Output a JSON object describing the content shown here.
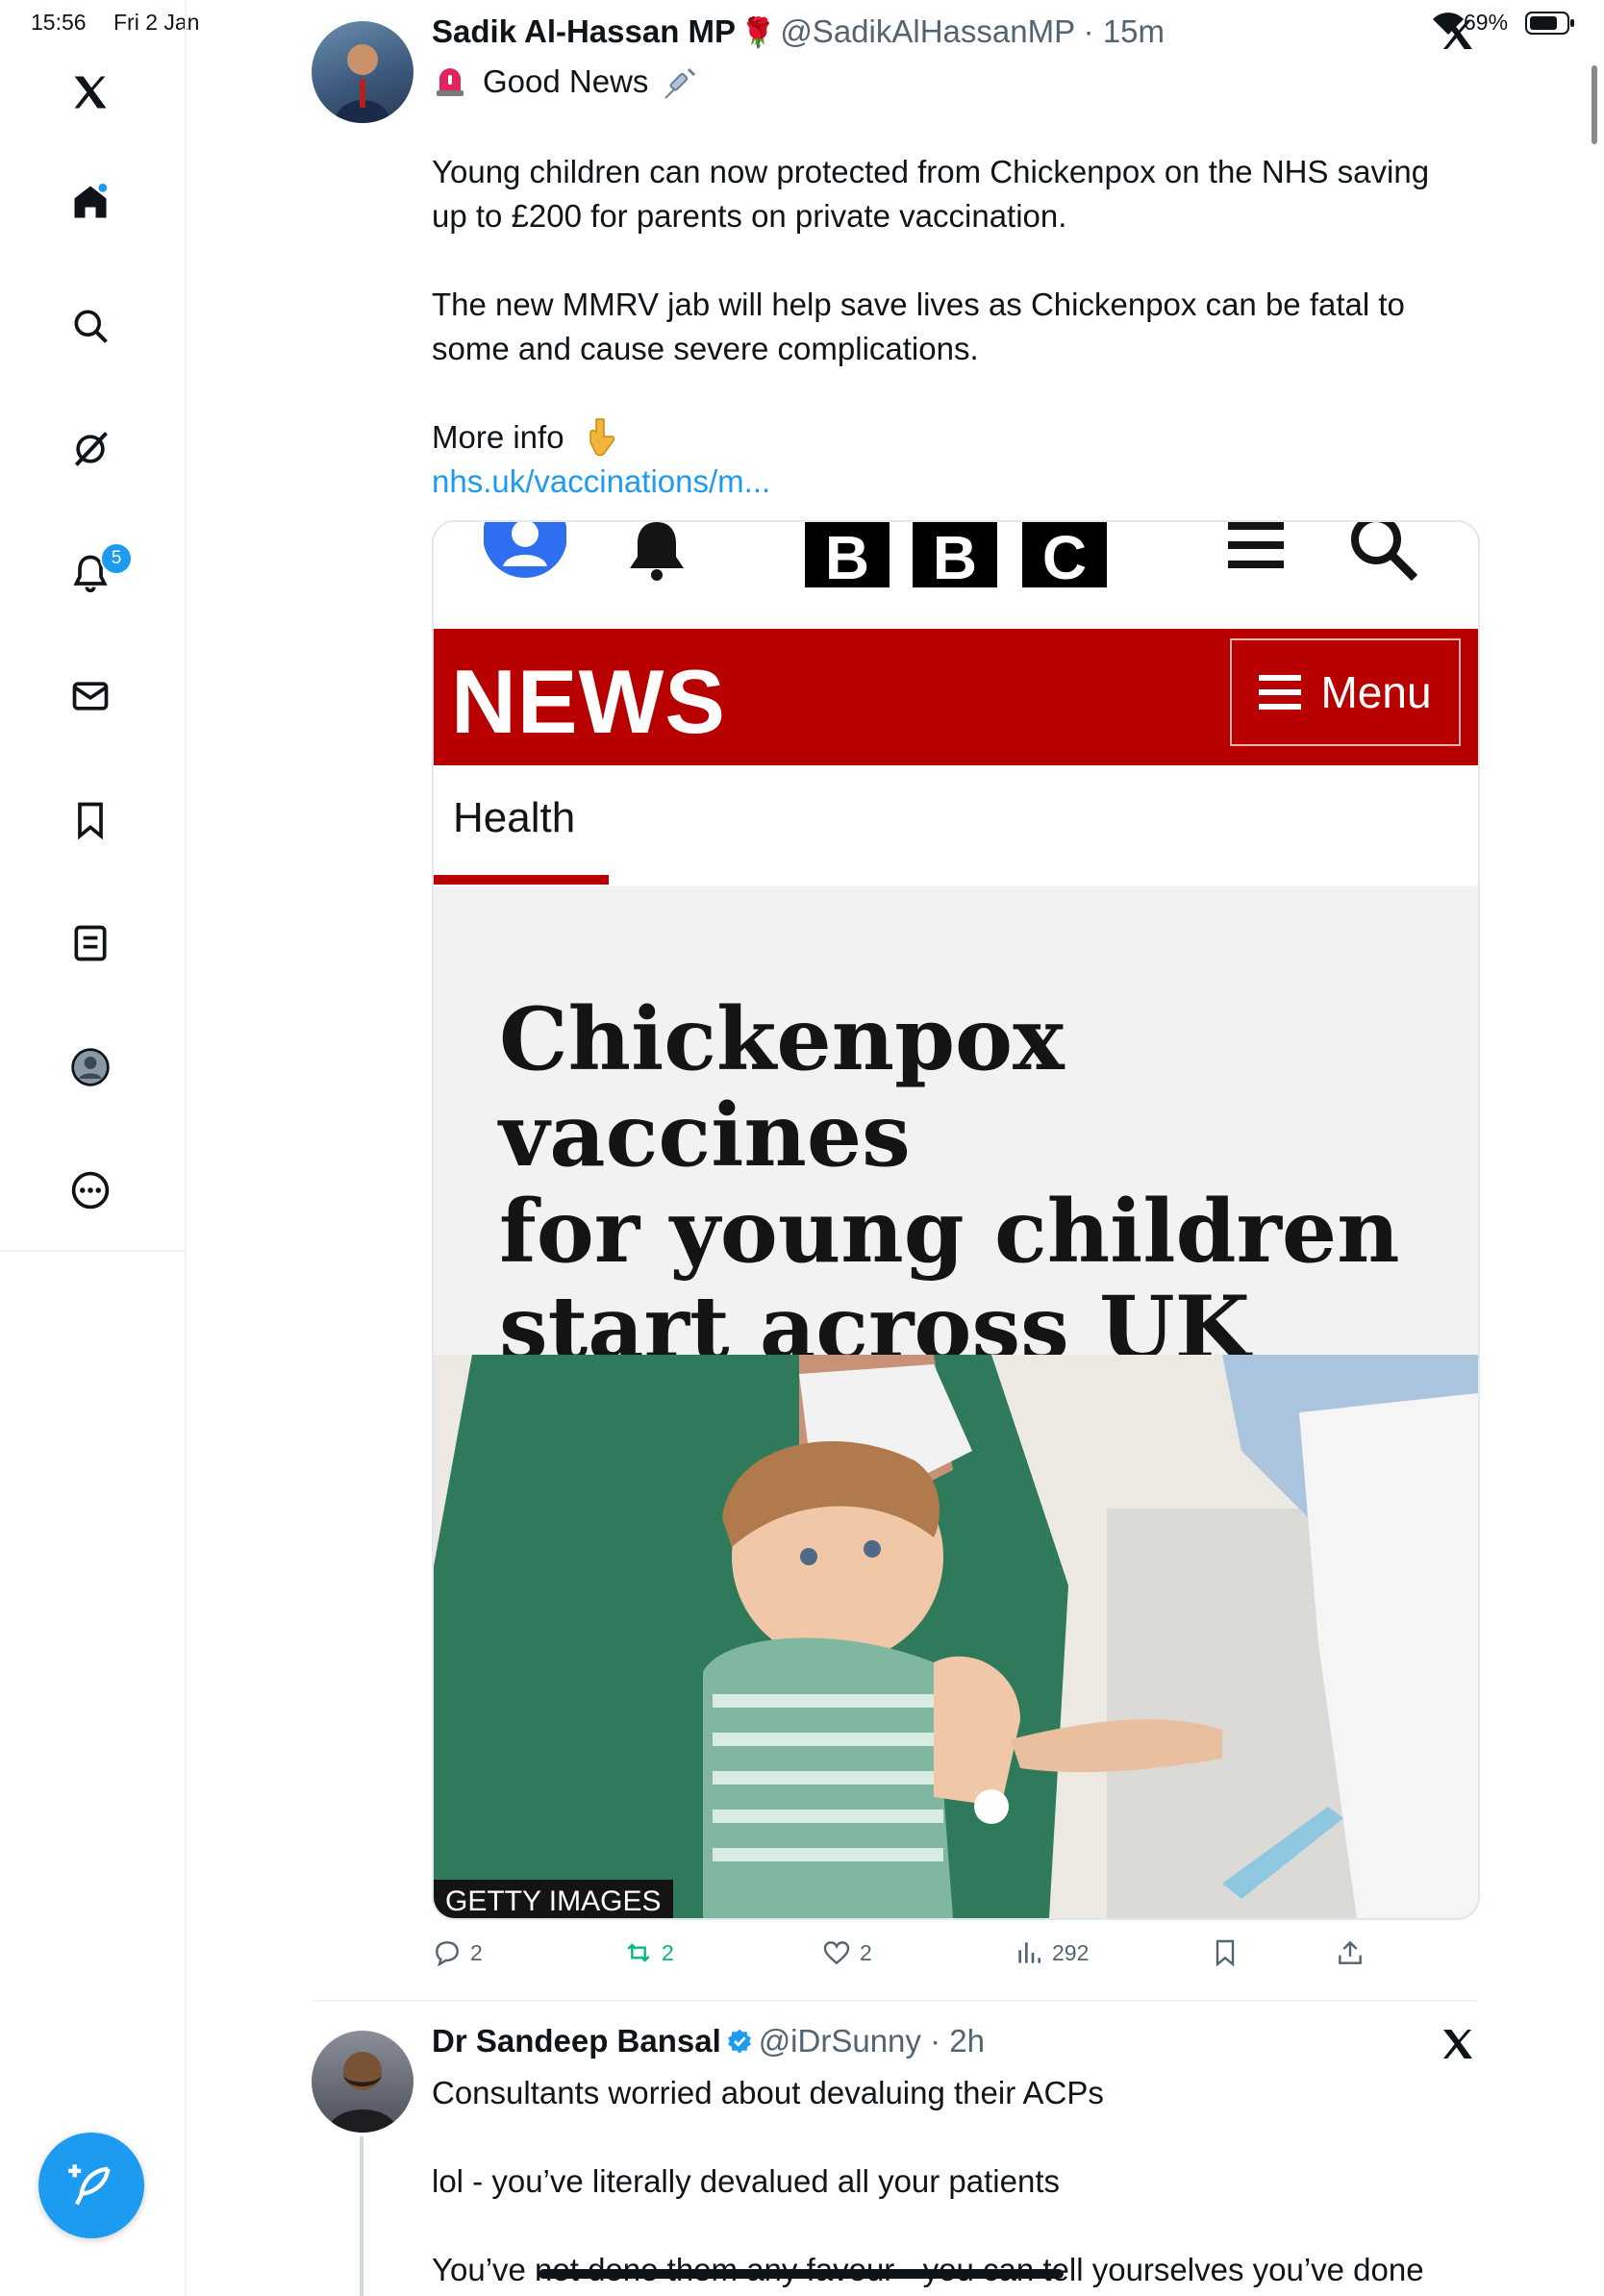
{
  "status_bar": {
    "time": "15:56",
    "date": "Fri 2 Jan",
    "battery": "69%"
  },
  "sidebar": {
    "items": [
      {
        "icon": "x-logo-icon"
      },
      {
        "icon": "home-icon"
      },
      {
        "icon": "search-icon"
      },
      {
        "icon": "grok-icon"
      },
      {
        "icon": "bell-icon",
        "badge": "5"
      },
      {
        "icon": "mail-icon"
      },
      {
        "icon": "bookmark-icon"
      },
      {
        "icon": "list-icon"
      },
      {
        "icon": "profile-icon"
      },
      {
        "icon": "more-icon"
      }
    ]
  },
  "tweet1": {
    "name": "Sadik Al-Hassan MP",
    "name_emoji": "🌹",
    "handle": "@SadikAlHassanMP",
    "time": "15m",
    "line1": "Good News",
    "paragraph1_line1": "Young children can now protected from Chickenpox on the NHS saving",
    "paragraph1_line2": "up to £200 for parents on private vaccination.",
    "paragraph2_line1": "The new MMRV jab will help save lives as Chickenpox can be fatal to",
    "paragraph2_line2": "some and cause severe complications.",
    "more_info": "More info",
    "link": "nhs.uk/vaccinations/m...",
    "card": {
      "bbc_letters": [
        "B",
        "B",
        "C"
      ],
      "news": "NEWS",
      "menu": "Menu",
      "section": "Health",
      "headline_line1": "Chickenpox vaccines",
      "headline_line2": "for young children",
      "headline_line3": "start across UK",
      "credit": "GETTY IMAGES"
    },
    "stats": {
      "replies": "2",
      "reposts": "2",
      "likes": "2",
      "views": "292"
    }
  },
  "tweet2": {
    "name": "Dr Sandeep Bansal",
    "handle": "@iDrSunny",
    "time": "2h",
    "line1": "Consultants worried about devaluing their ACPs",
    "line2": "lol - you’ve literally devalued all your patients",
    "line3": "You’ve not done them any favour - you can tell yourselves you’ve done"
  },
  "colors": {
    "accent": "#1d9bf0",
    "bbc_red": "#b80000",
    "repost_green": "#00ba7c"
  }
}
